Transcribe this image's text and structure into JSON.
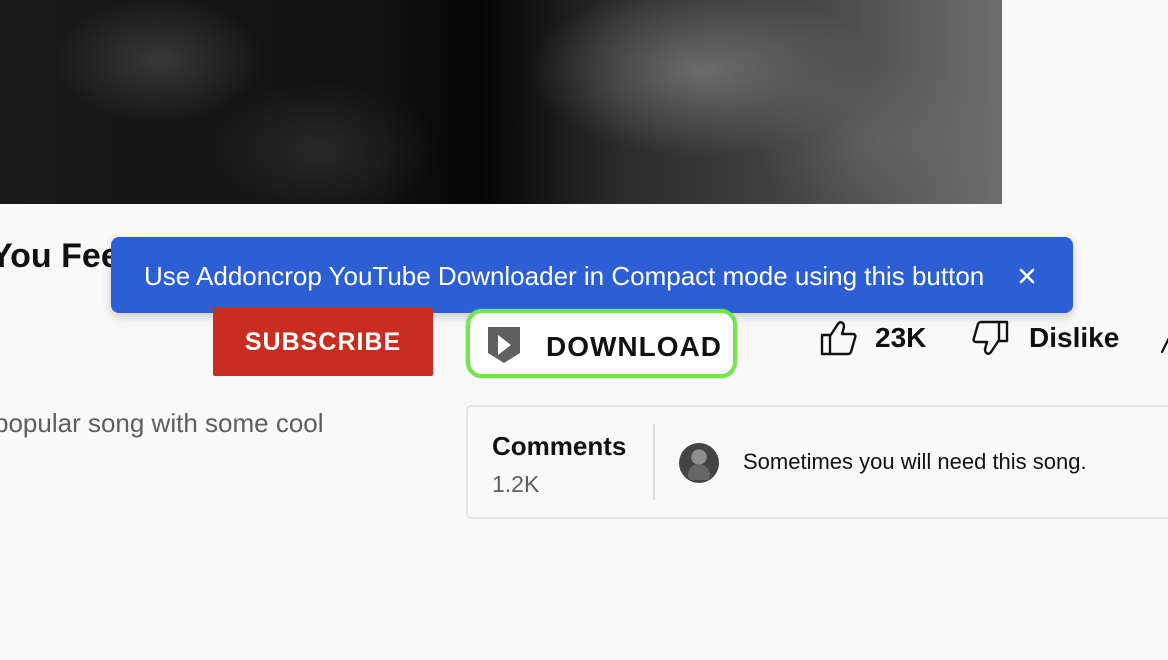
{
  "video": {
    "title": "You Fee"
  },
  "tooltip": {
    "message": "Use Addoncrop YouTube Downloader in Compact mode using this button",
    "close_label": "×"
  },
  "actions": {
    "subscribe_label": "SUBSCRIBE",
    "download_label": "DOWNLOAD",
    "like_count": "23K",
    "dislike_label": "Dislike"
  },
  "description": {
    "text": "popular song with some cool"
  },
  "comments": {
    "title": "Comments",
    "count": "1.2K",
    "top_comment": "Sometimes you will need this song."
  },
  "colors": {
    "tooltip": "#2b5fd3",
    "subscribe": "#c82d20",
    "download_border": "#73e64c",
    "background": "#f9f9f9"
  },
  "icons": {
    "download": "play-shield-icon",
    "like": "thumbs-up-icon",
    "dislike": "thumbs-down-icon",
    "share": "share-icon",
    "close": "close-icon"
  }
}
